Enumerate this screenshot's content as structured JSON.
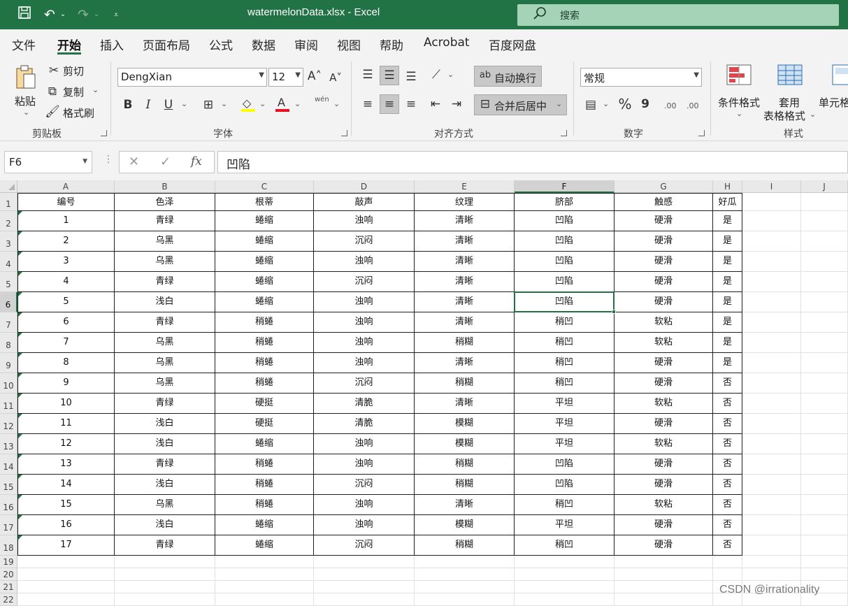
{
  "window": {
    "title": "watermelonData.xlsx  -  Excel",
    "search_label": "搜索",
    "icons": [
      "save-icon",
      "undo-icon",
      "redo-icon",
      "customize-qat-icon",
      "search-icon"
    ]
  },
  "menu": {
    "tabs": [
      "文件",
      "开始",
      "插入",
      "页面布局",
      "公式",
      "数据",
      "审阅",
      "视图",
      "帮助",
      "Acrobat",
      "百度网盘"
    ],
    "active_tab": "开始"
  },
  "ribbon": {
    "clipboard": {
      "group_label": "剪贴板",
      "paste": "粘贴",
      "cut": "剪切",
      "copy": "复制",
      "format_painter": "格式刷"
    },
    "font": {
      "group_label": "字体",
      "font_name": "DengXian",
      "font_size": "12",
      "bold": "B",
      "italic": "I",
      "underline": "U",
      "phonetic": "wén"
    },
    "alignment": {
      "group_label": "对齐方式",
      "wrap_text": "自动换行",
      "merge_center": "合并后居中"
    },
    "number": {
      "group_label": "数字",
      "format": "常规",
      "percent": "%",
      "comma": "9",
      "inc_decimal": ".00",
      "dec_decimal": ".00"
    },
    "styles": {
      "group_label": "样式",
      "conditional_format": "条件格式",
      "format_as_table_1": "套用",
      "format_as_table_2": "表格格式",
      "cell_styles": "单元格"
    }
  },
  "formula_bar": {
    "name_box": "F6",
    "fx": "fx",
    "content": "凹陷"
  },
  "sheet": {
    "columns": [
      "A",
      "B",
      "C",
      "D",
      "E",
      "F",
      "G",
      "H",
      "I",
      "J"
    ],
    "selected_column": "F",
    "selected_row": 6,
    "active_cell": "F6",
    "row_numbers": [
      1,
      2,
      3,
      4,
      5,
      6,
      7,
      8,
      9,
      10,
      11,
      12,
      13,
      14,
      15,
      16,
      17,
      18,
      19,
      20,
      21,
      22
    ],
    "header_row": [
      "编号",
      "色泽",
      "根蒂",
      "敲声",
      "纹理",
      "脐部",
      "触感",
      "好瓜"
    ],
    "rows": [
      [
        "1",
        "青绿",
        "蜷缩",
        "浊响",
        "清晰",
        "凹陷",
        "硬滑",
        "是"
      ],
      [
        "2",
        "乌黑",
        "蜷缩",
        "沉闷",
        "清晰",
        "凹陷",
        "硬滑",
        "是"
      ],
      [
        "3",
        "乌黑",
        "蜷缩",
        "浊响",
        "清晰",
        "凹陷",
        "硬滑",
        "是"
      ],
      [
        "4",
        "青绿",
        "蜷缩",
        "沉闷",
        "清晰",
        "凹陷",
        "硬滑",
        "是"
      ],
      [
        "5",
        "浅白",
        "蜷缩",
        "浊响",
        "清晰",
        "凹陷",
        "硬滑",
        "是"
      ],
      [
        "6",
        "青绿",
        "稍蜷",
        "浊响",
        "清晰",
        "稍凹",
        "软粘",
        "是"
      ],
      [
        "7",
        "乌黑",
        "稍蜷",
        "浊响",
        "稍糊",
        "稍凹",
        "软粘",
        "是"
      ],
      [
        "8",
        "乌黑",
        "稍蜷",
        "浊响",
        "清晰",
        "稍凹",
        "硬滑",
        "是"
      ],
      [
        "9",
        "乌黑",
        "稍蜷",
        "沉闷",
        "稍糊",
        "稍凹",
        "硬滑",
        "否"
      ],
      [
        "10",
        "青绿",
        "硬挺",
        "清脆",
        "清晰",
        "平坦",
        "软粘",
        "否"
      ],
      [
        "11",
        "浅白",
        "硬挺",
        "清脆",
        "模糊",
        "平坦",
        "硬滑",
        "否"
      ],
      [
        "12",
        "浅白",
        "蜷缩",
        "浊响",
        "模糊",
        "平坦",
        "软粘",
        "否"
      ],
      [
        "13",
        "青绿",
        "稍蜷",
        "浊响",
        "稍糊",
        "凹陷",
        "硬滑",
        "否"
      ],
      [
        "14",
        "浅白",
        "稍蜷",
        "沉闷",
        "稍糊",
        "凹陷",
        "硬滑",
        "否"
      ],
      [
        "15",
        "乌黑",
        "稍蜷",
        "浊响",
        "清晰",
        "稍凹",
        "软粘",
        "否"
      ],
      [
        "16",
        "浅白",
        "蜷缩",
        "浊响",
        "模糊",
        "平坦",
        "硬滑",
        "否"
      ],
      [
        "17",
        "青绿",
        "蜷缩",
        "沉闷",
        "稍糊",
        "稍凹",
        "硬滑",
        "否"
      ]
    ]
  },
  "watermark": "CSDN @irrationality",
  "colors": {
    "excel_green": "#217346",
    "search_bg": "#a5d3b7",
    "ribbon_bg": "#f3f3f3"
  }
}
